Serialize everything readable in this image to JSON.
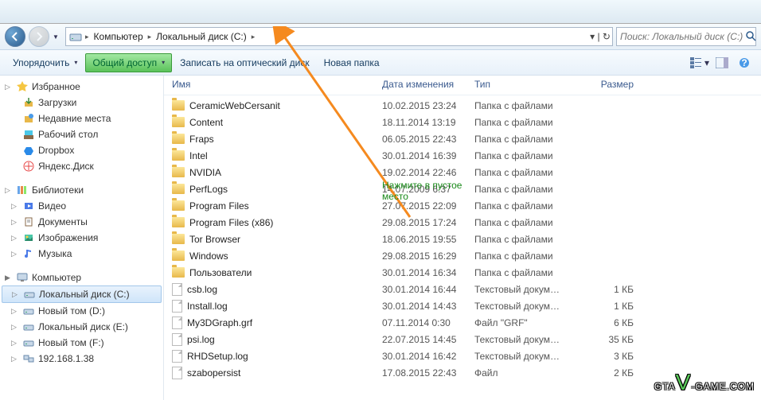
{
  "breadcrumb": {
    "seg1": "Компьютер",
    "seg2": "Локальный диск (C:)"
  },
  "search": {
    "placeholder": "Поиск: Локальный диск (C:)"
  },
  "toolbar": {
    "organize": "Упорядочить",
    "share": "Общий доступ",
    "burn": "Записать на оптический диск",
    "newfolder": "Новая папка"
  },
  "sidebar": {
    "favorites": "Избранное",
    "fav_items": [
      "Загрузки",
      "Недавние места",
      "Рабочий стол",
      "Dropbox",
      "Яндекс.Диск"
    ],
    "libraries": "Библиотеки",
    "lib_items": [
      "Видео",
      "Документы",
      "Изображения",
      "Музыка"
    ],
    "computer": "Компьютер",
    "comp_items": [
      "Локальный диск (C:)",
      "Новый том (D:)",
      "Локальный диск (E:)",
      "Новый том (F:)",
      "192.168.1.38"
    ]
  },
  "columns": {
    "name": "Имя",
    "date": "Дата изменения",
    "type": "Тип",
    "size": "Размер"
  },
  "files": [
    {
      "icon": "folder",
      "name": "CeramicWebCersanit",
      "date": "10.02.2015 23:24",
      "type": "Папка с файлами",
      "size": ""
    },
    {
      "icon": "folder",
      "name": "Content",
      "date": "18.11.2014 13:19",
      "type": "Папка с файлами",
      "size": ""
    },
    {
      "icon": "folder",
      "name": "Fraps",
      "date": "06.05.2015 22:43",
      "type": "Папка с файлами",
      "size": ""
    },
    {
      "icon": "folder",
      "name": "Intel",
      "date": "30.01.2014 16:39",
      "type": "Папка с файлами",
      "size": ""
    },
    {
      "icon": "folder",
      "name": "NVIDIA",
      "date": "19.02.2014 22:46",
      "type": "Папка с файлами",
      "size": ""
    },
    {
      "icon": "folder",
      "name": "PerfLogs",
      "date": "14.07.2009 6:37",
      "type": "Папка с файлами",
      "size": ""
    },
    {
      "icon": "folder",
      "name": "Program Files",
      "date": "27.07.2015 22:09",
      "type": "Папка с файлами",
      "size": ""
    },
    {
      "icon": "folder",
      "name": "Program Files (x86)",
      "date": "29.08.2015 17:24",
      "type": "Папка с файлами",
      "size": ""
    },
    {
      "icon": "folder",
      "name": "Tor Browser",
      "date": "18.06.2015 19:55",
      "type": "Папка с файлами",
      "size": ""
    },
    {
      "icon": "folder",
      "name": "Windows",
      "date": "29.08.2015 16:29",
      "type": "Папка с файлами",
      "size": ""
    },
    {
      "icon": "folder",
      "name": "Пользователи",
      "date": "30.01.2014 16:34",
      "type": "Папка с файлами",
      "size": ""
    },
    {
      "icon": "file",
      "name": "csb.log",
      "date": "30.01.2014 16:44",
      "type": "Текстовый докум…",
      "size": "1 КБ"
    },
    {
      "icon": "file",
      "name": "Install.log",
      "date": "30.01.2014 14:43",
      "type": "Текстовый докум…",
      "size": "1 КБ"
    },
    {
      "icon": "file",
      "name": "My3DGraph.grf",
      "date": "07.11.2014 0:30",
      "type": "Файл \"GRF\"",
      "size": "6 КБ"
    },
    {
      "icon": "file",
      "name": "psi.log",
      "date": "22.07.2015 14:45",
      "type": "Текстовый докум…",
      "size": "35 КБ"
    },
    {
      "icon": "file",
      "name": "RHDSetup.log",
      "date": "30.01.2014 16:42",
      "type": "Текстовый докум…",
      "size": "3 КБ"
    },
    {
      "icon": "file",
      "name": "szabopersist",
      "date": "17.08.2015 22:43",
      "type": "Файл",
      "size": "2 КБ"
    }
  ],
  "annotation": {
    "line1": "Нажмите в пустое",
    "line2": "место"
  },
  "watermark": {
    "p1": "GTA",
    "p2": "V",
    "p3": "-GAME.COM"
  }
}
